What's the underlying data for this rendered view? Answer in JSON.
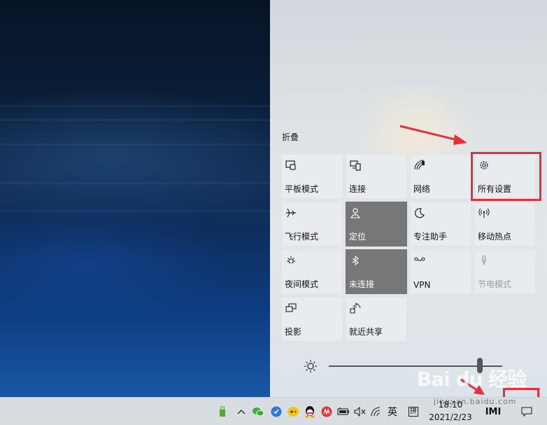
{
  "action_center": {
    "collapse_label": "折叠",
    "tiles": [
      {
        "label": "平板模式",
        "icon": "tablet-mode-icon",
        "state": "normal"
      },
      {
        "label": "连接",
        "icon": "connect-icon",
        "state": "normal"
      },
      {
        "label": "网络",
        "icon": "network-icon",
        "state": "normal"
      },
      {
        "label": "所有设置",
        "icon": "gear-icon",
        "state": "normal"
      },
      {
        "label": "飞行模式",
        "icon": "airplane-icon",
        "state": "normal"
      },
      {
        "label": "定位",
        "icon": "location-icon",
        "state": "active"
      },
      {
        "label": "专注助手",
        "icon": "moon-icon",
        "state": "normal"
      },
      {
        "label": "移动热点",
        "icon": "hotspot-icon",
        "state": "normal"
      },
      {
        "label": "夜间模式",
        "icon": "night-light-icon",
        "state": "normal"
      },
      {
        "label": "未连接",
        "icon": "bluetooth-icon",
        "state": "active"
      },
      {
        "label": "VPN",
        "icon": "vpn-icon",
        "state": "normal"
      },
      {
        "label": "节电模式",
        "icon": "battery-saver-icon",
        "state": "disabled"
      },
      {
        "label": "投影",
        "icon": "project-icon",
        "state": "normal"
      },
      {
        "label": "就近共享",
        "icon": "nearby-share-icon",
        "state": "normal"
      }
    ],
    "brightness": {
      "icon": "brightness-icon",
      "level": 0.87
    }
  },
  "taskbar": {
    "tray_icons": [
      "usb-icon",
      "chevron-up-icon",
      "wechat-icon",
      "shield-icon",
      "game-icon",
      "qq-icon",
      "music-icon",
      "battery-icon",
      "volume-muted-icon",
      "wifi-icon"
    ],
    "input_method": "英",
    "keyboard_symbol": "拼",
    "time": "18:10",
    "date": "2021/2/23",
    "imi_label": "IMI"
  },
  "watermark": {
    "logo": "Bai du 经验",
    "url": "jingyan.baidu.com"
  },
  "colors": {
    "highlight": "#e5303a",
    "tile_active": "#777777",
    "tile_normal": "#e8ecef"
  }
}
